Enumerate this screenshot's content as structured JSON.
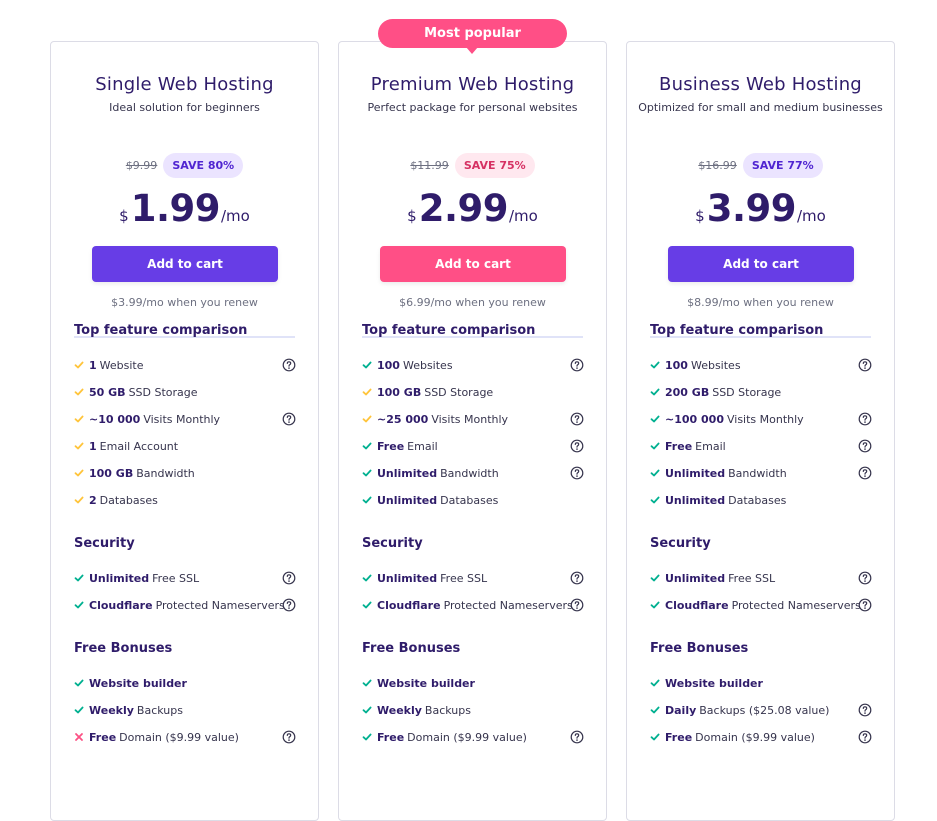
{
  "colors": {
    "purple": "#673de6",
    "pink": "#ff4f86",
    "check_green": "#00b090",
    "check_yellow": "#ffc43a",
    "cross_red": "#fc5185",
    "save_purple_bg": "#ebe4ff",
    "save_purple_text": "#5025d1",
    "save_pink_bg": "#ffe8ef",
    "save_pink_text": "#d63163"
  },
  "badge": {
    "label": "Most popular"
  },
  "plans": [
    {
      "title": "Single Web Hosting",
      "subtitle": "Ideal solution for beginners",
      "old_price": "$9.99",
      "save": "SAVE 80%",
      "currency": "$",
      "price": "1.99",
      "period": "/mo",
      "cta": "Add to cart",
      "renew": "$3.99/mo when you renew",
      "sections": [
        {
          "title": "Top feature comparison",
          "features": [
            {
              "bold": "1",
              "text": "Website",
              "icon": "check-icon",
              "help": true
            },
            {
              "bold": "50 GB",
              "text": "SSD Storage",
              "icon": "check-icon",
              "help": false
            },
            {
              "bold": "~10 000",
              "text": "Visits Monthly",
              "icon": "check-icon",
              "help": true
            },
            {
              "bold": "1",
              "text": "Email Account",
              "icon": "check-icon",
              "help": false
            },
            {
              "bold": "100 GB",
              "text": "Bandwidth",
              "icon": "check-icon",
              "help": false
            },
            {
              "bold": "2",
              "text": "Databases",
              "icon": "check-icon",
              "help": false
            }
          ]
        },
        {
          "title": "Security",
          "features": [
            {
              "bold": "Unlimited",
              "text": "Free SSL",
              "icon": "check-icon",
              "help": true
            },
            {
              "bold": "Cloudflare",
              "text": "Protected Nameservers",
              "icon": "check-icon",
              "help": true
            }
          ]
        },
        {
          "title": "Free Bonuses",
          "features": [
            {
              "bold": "Website builder",
              "text": "",
              "icon": "check-icon",
              "help": false
            },
            {
              "bold": "Weekly",
              "text": "Backups",
              "icon": "check-icon",
              "help": false
            },
            {
              "bold": "Free",
              "text": "Domain ($9.99 value)",
              "icon": "cross-icon",
              "help": true
            }
          ]
        }
      ]
    },
    {
      "title": "Premium Web Hosting",
      "subtitle": "Perfect package for personal websites",
      "old_price": "$11.99",
      "save": "SAVE 75%",
      "currency": "$",
      "price": "2.99",
      "period": "/mo",
      "cta": "Add to cart",
      "renew": "$6.99/mo when you renew",
      "sections": [
        {
          "title": "Top feature comparison",
          "features": [
            {
              "bold": "100",
              "text": "Websites",
              "icon": "check-icon",
              "help": true
            },
            {
              "bold": "100 GB",
              "text": "SSD Storage",
              "icon": "check-icon",
              "help": false
            },
            {
              "bold": "~25 000",
              "text": "Visits Monthly",
              "icon": "check-icon",
              "help": true
            },
            {
              "bold": "Free",
              "text": "Email",
              "icon": "check-icon",
              "help": true
            },
            {
              "bold": "Unlimited",
              "text": "Bandwidth",
              "icon": "check-icon",
              "help": true
            },
            {
              "bold": "Unlimited",
              "text": "Databases",
              "icon": "check-icon",
              "help": false
            }
          ]
        },
        {
          "title": "Security",
          "features": [
            {
              "bold": "Unlimited",
              "text": "Free SSL",
              "icon": "check-icon",
              "help": true
            },
            {
              "bold": "Cloudflare",
              "text": "Protected Nameservers",
              "icon": "check-icon",
              "help": true
            }
          ]
        },
        {
          "title": "Free Bonuses",
          "features": [
            {
              "bold": "Website builder",
              "text": "",
              "icon": "check-icon",
              "help": false
            },
            {
              "bold": "Weekly",
              "text": "Backups",
              "icon": "check-icon",
              "help": false
            },
            {
              "bold": "Free",
              "text": "Domain ($9.99 value)",
              "icon": "check-icon",
              "help": true
            }
          ]
        }
      ]
    },
    {
      "title": "Business Web Hosting",
      "subtitle": "Optimized for small and medium businesses",
      "old_price": "$16.99",
      "save": "SAVE 77%",
      "currency": "$",
      "price": "3.99",
      "period": "/mo",
      "cta": "Add to cart",
      "renew": "$8.99/mo when you renew",
      "sections": [
        {
          "title": "Top feature comparison",
          "features": [
            {
              "bold": "100",
              "text": "Websites",
              "icon": "check-icon",
              "help": true
            },
            {
              "bold": "200 GB",
              "text": "SSD Storage",
              "icon": "check-icon",
              "help": false
            },
            {
              "bold": "~100 000",
              "text": "Visits Monthly",
              "icon": "check-icon",
              "help": true
            },
            {
              "bold": "Free",
              "text": "Email",
              "icon": "check-icon",
              "help": true
            },
            {
              "bold": "Unlimited",
              "text": "Bandwidth",
              "icon": "check-icon",
              "help": true
            },
            {
              "bold": "Unlimited",
              "text": "Databases",
              "icon": "check-icon",
              "help": false
            }
          ]
        },
        {
          "title": "Security",
          "features": [
            {
              "bold": "Unlimited",
              "text": "Free SSL",
              "icon": "check-icon",
              "help": true
            },
            {
              "bold": "Cloudflare",
              "text": "Protected Nameservers",
              "icon": "check-icon",
              "help": true
            }
          ]
        },
        {
          "title": "Free Bonuses",
          "features": [
            {
              "bold": "Website builder",
              "text": "",
              "icon": "check-icon",
              "help": false
            },
            {
              "bold": "Daily",
              "text": "Backups ($25.08 value)",
              "icon": "check-icon",
              "help": true
            },
            {
              "bold": "Free",
              "text": "Domain ($9.99 value)",
              "icon": "check-icon",
              "help": true
            }
          ]
        }
      ]
    }
  ]
}
